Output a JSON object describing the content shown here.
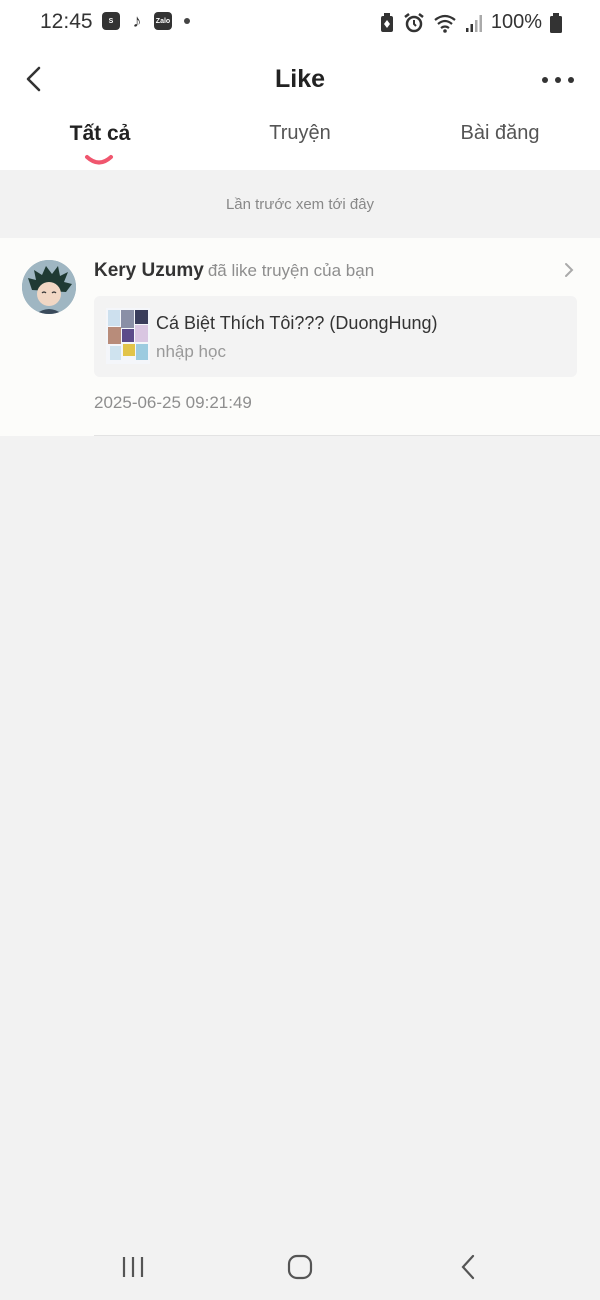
{
  "status_bar": {
    "time": "12:45",
    "apps": [
      "shopee-icon",
      "tiktok-icon",
      "zalo-icon"
    ],
    "zalo_label": "Zalo",
    "battery_percent": "100%"
  },
  "header": {
    "title": "Like",
    "back_icon": "chevron-left-icon",
    "more_icon": "more-horizontal-icon"
  },
  "tabs": [
    {
      "label": "Tất cả",
      "active": true
    },
    {
      "label": "Truyện",
      "active": false
    },
    {
      "label": "Bài đăng",
      "active": false
    }
  ],
  "banner_text": "Lần trước xem tới đây",
  "notification": {
    "user": "Kery Uzumy",
    "action": "đã like truyện của bạn",
    "story_title": "Cá Biệt Thích Tôi??? (DuongHung)",
    "chapter": "nhập học",
    "timestamp": "2025-06-25 09:21:49"
  },
  "colors": {
    "accent": "#f0566e",
    "background": "#f2f2f2"
  },
  "nav_bar": [
    "recents-icon",
    "home-icon",
    "back-icon"
  ]
}
